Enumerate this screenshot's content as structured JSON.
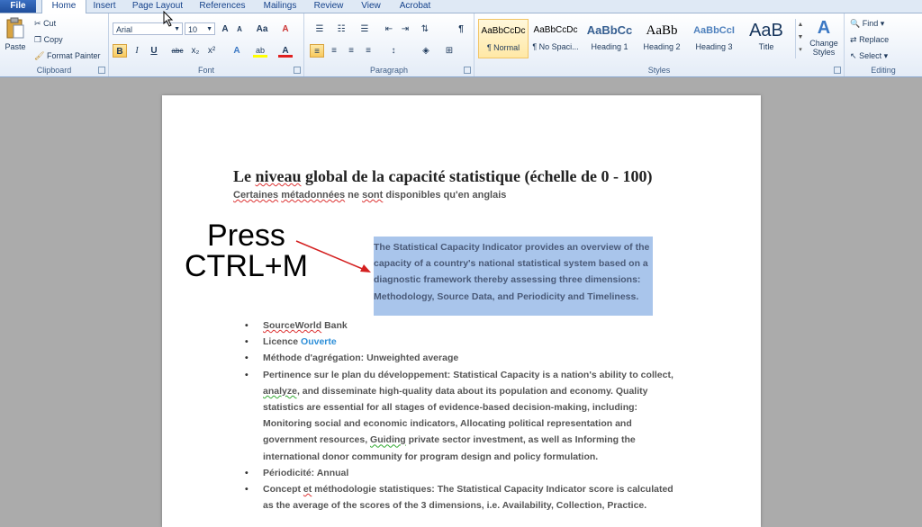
{
  "tabs": [
    "File",
    "Home",
    "Insert",
    "Page Layout",
    "References",
    "Mailings",
    "Review",
    "View",
    "Acrobat"
  ],
  "clipboard": {
    "paste": "Paste",
    "cut": "Cut",
    "copy": "Copy",
    "format_painter": "Format Painter",
    "label": "Clipboard"
  },
  "font": {
    "name": "Arial",
    "size": "10",
    "grow": "A",
    "shrink": "A",
    "case": "Aa",
    "clear": "A",
    "bold": "B",
    "italic": "I",
    "underline": "U",
    "strike": "abc",
    "sub": "x₂",
    "sup": "x²",
    "effects": "A",
    "highlight": "ab",
    "color": "A",
    "label": "Font"
  },
  "paragraph": {
    "label": "Paragraph",
    "pilcrow": "¶"
  },
  "styles": {
    "label": "Styles",
    "items": [
      {
        "preview": "AaBbCcDc",
        "name": "¶ Normal"
      },
      {
        "preview": "AaBbCcDc",
        "name": "¶ No Spaci..."
      },
      {
        "preview": "AaBbCc",
        "name": "Heading 1"
      },
      {
        "preview": "AaBb",
        "name": "Heading 2"
      },
      {
        "preview": "AaBbCcI",
        "name": "Heading 3"
      },
      {
        "preview": "AaB",
        "name": "Title"
      }
    ],
    "change": "Change Styles"
  },
  "editing": {
    "find": "Find",
    "replace": "Replace",
    "select": "Select",
    "label": "Editing"
  },
  "document": {
    "title_pre": "Le ",
    "title_err": "niveau",
    "title_post": " global de la capacité statistique (échelle de 0 - 100)",
    "subtitle_a": "Certaines",
    "subtitle_b": " ",
    "subtitle_c": "métadonnées",
    "subtitle_d": " ne ",
    "subtitle_e": "sont",
    "subtitle_f": " disponibles qu'en anglais",
    "highlight_lines": [
      "The Statistical Capacity Indicator provides an overview of the",
      "capacity of a country's national statistical system based on a",
      "diagnostic framework thereby assessing three dimensions:",
      "Methodology, Source Data, and Periodicity and Timeliness."
    ],
    "b1_a": "SourceWorld",
    "b1_b": " Bank",
    "b2_a": "Licence ",
    "b2_b": "Ouverte",
    "b3": "Méthode d'agrégation: Unweighted average",
    "b4_l1": "Pertinence sur le plan du développement: Statistical Capacity is a nation's ability to collect,",
    "b4_l2a": "analyze,",
    "b4_l2b": " and disseminate high-quality data about its population and economy. Quality",
    "b4_l3": "statistics are essential for all stages of evidence-based decision-making, including:",
    "b4_l4": "Monitoring social and economic indicators, Allocating political representation and",
    "b4_l5a": "government resources, ",
    "b4_l5b": "Guiding",
    "b4_l5c": " private sector investment, as well as Informing the",
    "b4_l6": "international donor community for program design and policy formulation.",
    "b5": "Périodicité: Annual",
    "b6_l1a": "Concept ",
    "b6_l1b": "et",
    "b6_l1c": " méthodologie statistiques: The Statistical Capacity Indicator score is calculated",
    "b6_l2": "as the average of the scores of the 3 dimensions, i.e. Availability, Collection, Practice."
  },
  "overlay": {
    "line1": "Press",
    "line2": "CTRL+M",
    "arrow_color": "#d42020"
  },
  "colors": {
    "file_tab": "#2b579a",
    "selection": "#a9c5eb",
    "link": "#2e8fd8"
  }
}
